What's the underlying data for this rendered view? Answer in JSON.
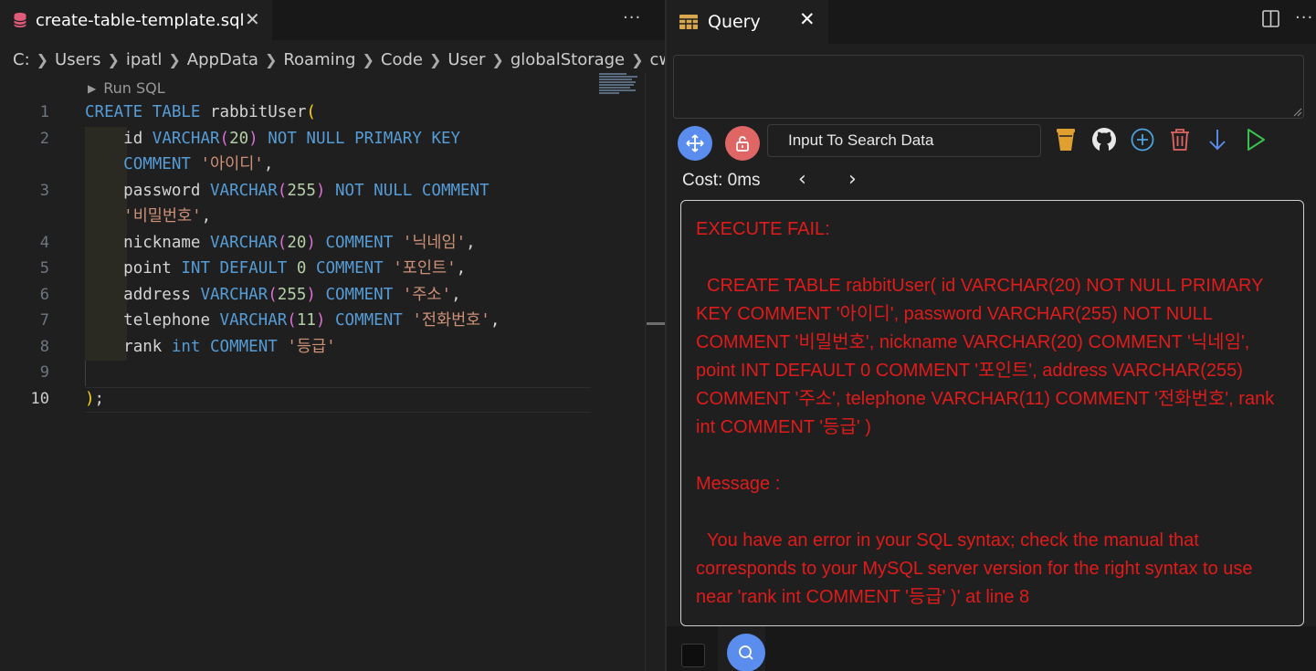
{
  "editor": {
    "tab_title": "create-table-template.sql",
    "breadcrumb": [
      "C:",
      "Users",
      "ipatl",
      "AppData",
      "Roaming",
      "Code",
      "User",
      "globalStorage",
      "cweijan"
    ],
    "codelens": "Run SQL",
    "line_numbers": [
      "1",
      "2",
      "3",
      "4",
      "5",
      "6",
      "7",
      "8",
      "9",
      "10"
    ],
    "code_lines": [
      "CREATE TABLE rabbitUser(",
      "    id VARCHAR(20) NOT NULL PRIMARY KEY",
      "    COMMENT '아이디',",
      "    password VARCHAR(255) NOT NULL COMMENT",
      "    '비밀번호',",
      "    nickname VARCHAR(20) COMMENT '닉네임',",
      "    point INT DEFAULT 0 COMMENT '포인트',",
      "    address VARCHAR(255) COMMENT '주소',",
      "    telephone VARCHAR(11) COMMENT '전화번호',",
      "    rank int COMMENT '등급'",
      "",
      ");"
    ],
    "active_line": "10"
  },
  "query_panel": {
    "tab_title": "Query",
    "sql_input_value": "",
    "search_placeholder": "Input To Search Data",
    "cost_label": "Cost: 0ms",
    "result": {
      "heading": "EXECUTE FAIL:",
      "sql": "CREATE TABLE rabbitUser( id VARCHAR(20) NOT NULL PRIMARY KEY COMMENT '아이디', password VARCHAR(255) NOT NULL COMMENT '비밀번호', nickname VARCHAR(20) COMMENT '닉네임', point INT DEFAULT 0 COMMENT '포인트', address VARCHAR(255) COMMENT '주소', telephone VARCHAR(11) COMMENT '전화번호', rank int COMMENT '등급' )",
      "message_label": "Message :",
      "message": "You have an error in your SQL syntax; check the manual that corresponds to your MySQL server version for the right syntax to use near 'rank int COMMENT '등급' )' at line 8"
    },
    "toolbar_icons": [
      "move-icon",
      "unlock-icon",
      "coffee-cup-icon",
      "github-icon",
      "add-circle-icon",
      "trash-icon",
      "arrow-down-icon",
      "run-icon"
    ]
  },
  "colors": {
    "error_text": "#e01b1b",
    "accent_blue": "#5b8def",
    "lock_red": "#e06666",
    "keyword": "#569cd6",
    "string": "#ce9178",
    "number": "#b5cea8"
  }
}
